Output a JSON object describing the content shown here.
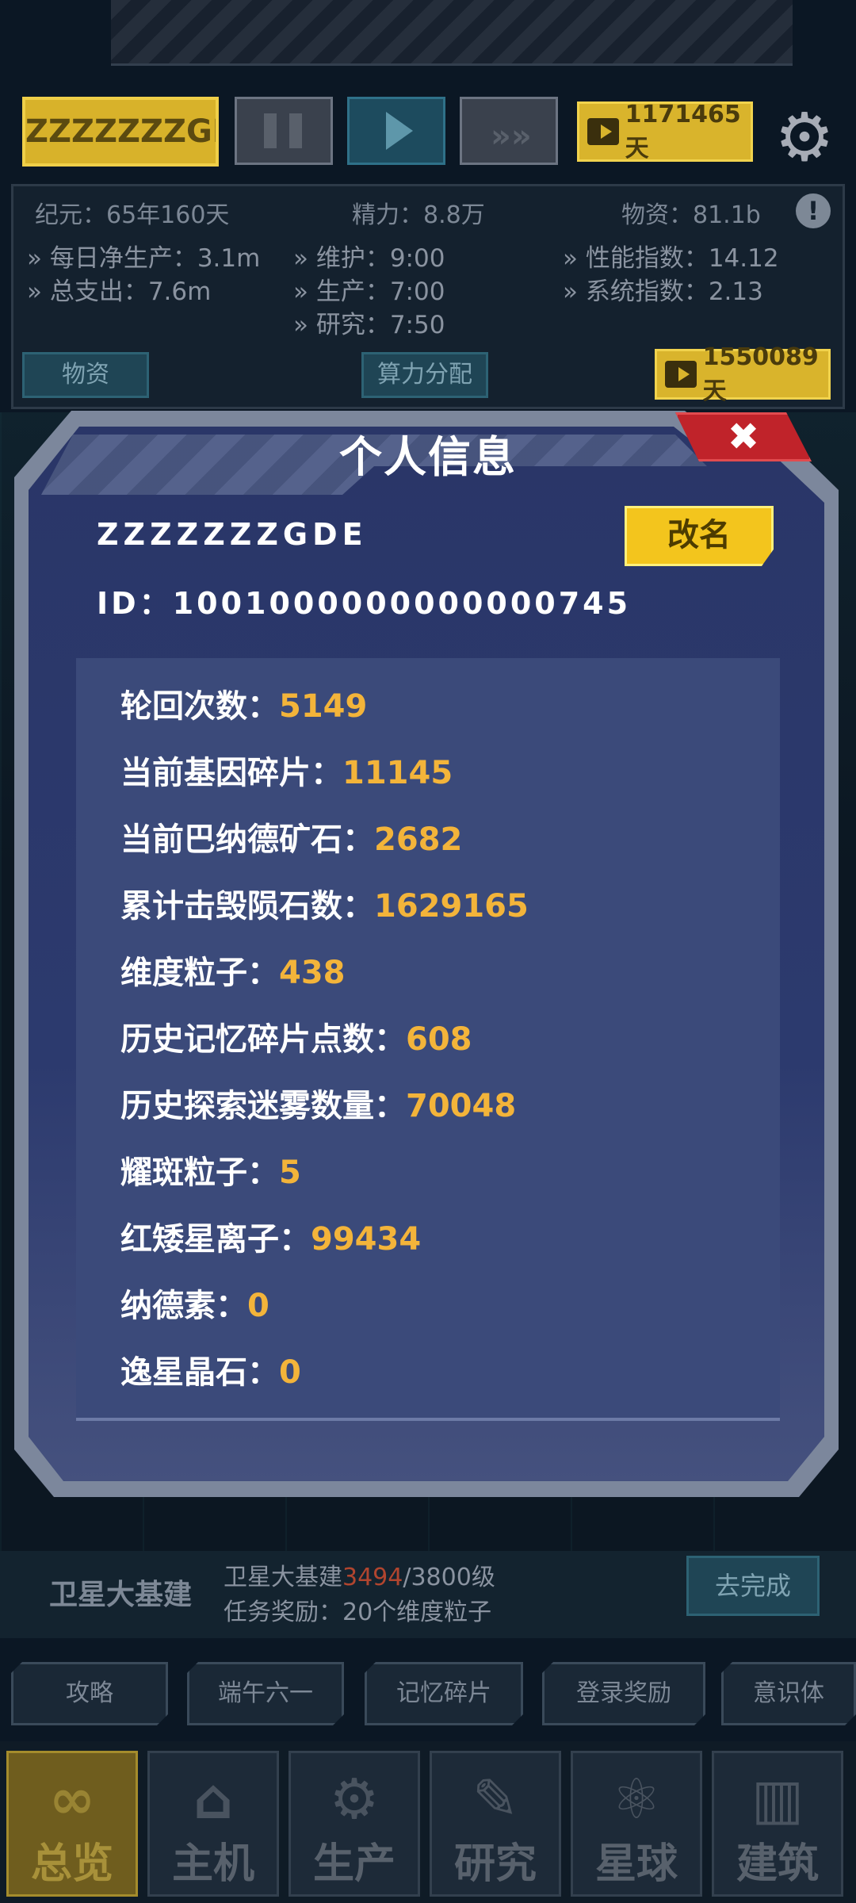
{
  "topbar": {
    "player_name": "ZZZZZZZGDE",
    "video_reward_1": "1171465天",
    "video_reward_2": "1550089天"
  },
  "stats": {
    "era": "纪元：65年160天",
    "energy": "精力：8.8万",
    "supplies": "物资：81.1b",
    "daily_net": "每日净生产：3.1m",
    "total_spend": "总支出：7.6m",
    "maintain": "维护：9:00",
    "produce": "生产：7:00",
    "research": "研究：7:50",
    "perf_index": "性能指数：14.12",
    "sys_index": "系统指数：2.13",
    "tab_supplies": "物资",
    "tab_compute": "算力分配"
  },
  "modal": {
    "title": "个人信息",
    "close_symbol": "✖",
    "username": "ZZZZZZZGDE",
    "id_label": "ID：",
    "id_value": "1001000000000000745",
    "rename_label": "改名",
    "rows": [
      {
        "label": "轮回次数：",
        "value": "5149"
      },
      {
        "label": "当前基因碎片：",
        "value": "11145"
      },
      {
        "label": "当前巴纳德矿石：",
        "value": "2682"
      },
      {
        "label": "累计击毁陨石数：",
        "value": "1629165"
      },
      {
        "label": "维度粒子：",
        "value": "438"
      },
      {
        "label": "历史记忆碎片点数：",
        "value": "608"
      },
      {
        "label": "历史探索迷雾数量：",
        "value": "70048"
      },
      {
        "label": "耀斑粒子：",
        "value": "5"
      },
      {
        "label": "红矮星离子：",
        "value": "99434"
      },
      {
        "label": "纳德素：",
        "value": "0"
      },
      {
        "label": "逸星晶石：",
        "value": "0"
      }
    ]
  },
  "task": {
    "title": "卫星大基建",
    "progress_prefix": "卫星大基建",
    "progress_current": "3494",
    "progress_total": "/3800级",
    "reward": "任务奖励：20个维度粒子",
    "button": "去完成"
  },
  "chips": [
    "攻略",
    "端午六一",
    "记忆碎片",
    "登录奖励",
    "意识体"
  ],
  "nav": [
    {
      "label": "总览",
      "icon": "∞"
    },
    {
      "label": "主机",
      "icon": "⌂"
    },
    {
      "label": "生产",
      "icon": "⚙"
    },
    {
      "label": "研究",
      "icon": "✎"
    },
    {
      "label": "星球",
      "icon": "⚛"
    },
    {
      "label": "建筑",
      "icon": "▥"
    }
  ]
}
